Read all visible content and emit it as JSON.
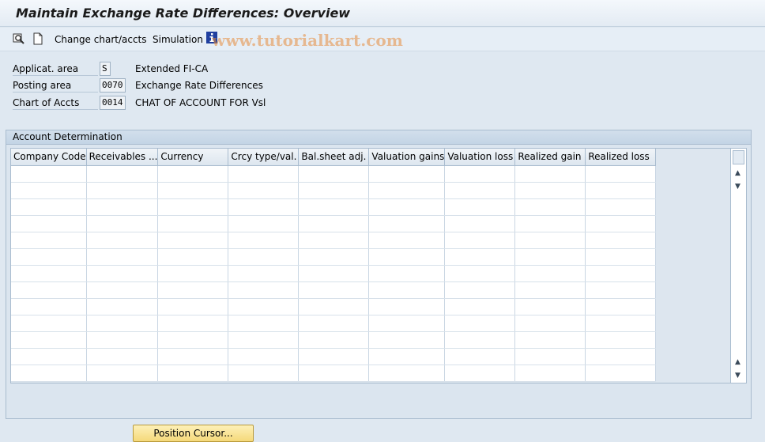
{
  "window": {
    "title": "Maintain Exchange Rate Differences: Overview"
  },
  "toolbar": {
    "change_chart": "Change chart/accts",
    "simulation": "Simulation"
  },
  "watermark": "www.tutorialkart.com",
  "fields": [
    {
      "label": "Applicat. area",
      "value": "S",
      "description": "Extended FI-CA"
    },
    {
      "label": "Posting area",
      "value": "0070",
      "description": "Exchange Rate Differences"
    },
    {
      "label": "Chart of Accts",
      "value": "0014",
      "description": "CHAT OF ACCOUNT FOR Vsl"
    }
  ],
  "group": {
    "title": "Account Determination",
    "columns": [
      "Company Code",
      "Receivables ...",
      "Currency",
      "Crcy type/val.",
      "Bal.sheet adj.",
      "Valuation gains",
      "Valuation loss",
      "Realized gain",
      "Realized loss"
    ]
  },
  "buttons": {
    "position_cursor": "Position Cursor..."
  },
  "colors": {
    "accent": "#f5d97a",
    "background": "#dfe8f1",
    "info_icon": "#1f3f9f"
  }
}
